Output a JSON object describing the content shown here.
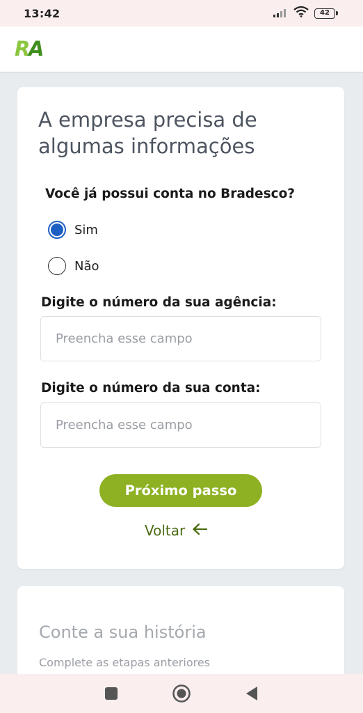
{
  "status_bar": {
    "time": "13:42",
    "battery": "42",
    "icons": [
      "signal-icon",
      "wifi-icon",
      "battery-icon"
    ]
  },
  "header": {
    "logo_text": "RA",
    "colors": {
      "logo_green": "#8cc63f",
      "logo_dark": "#3f8f1f"
    }
  },
  "form": {
    "title": "A empresa precisa de algumas informações",
    "question": "Você já possui conta no Bradesco?",
    "options": [
      {
        "label": "Sim",
        "checked": true
      },
      {
        "label": "Não",
        "checked": false
      }
    ],
    "agencia_label": "Digite o número da sua agência:",
    "agencia_placeholder": "Preencha esse campo",
    "agencia_value": "",
    "conta_label": "Digite o número da sua conta:",
    "conta_placeholder": "Preencha esse campo",
    "conta_value": "",
    "next_button": "Próximo passo",
    "back_link": "Voltar"
  },
  "next_section": {
    "title": "Conte a sua história",
    "subtitle": "Complete as etapas anteriores"
  },
  "colors": {
    "accent": "#8db122",
    "radio": "#1e5fc4",
    "back_link": "#4a6b12"
  }
}
